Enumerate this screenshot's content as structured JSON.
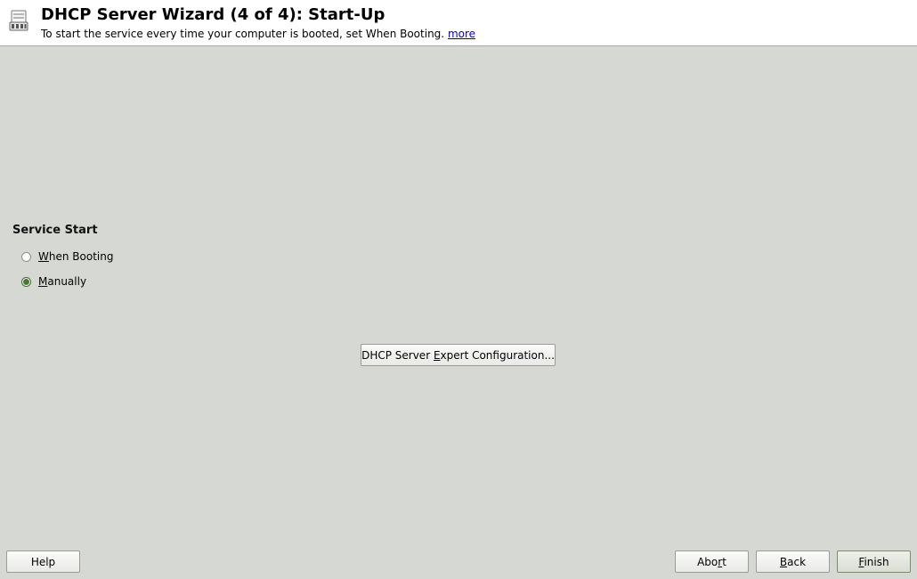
{
  "header": {
    "title": "DHCP Server Wizard (4 of 4): Start-Up",
    "subtitle": "To start the service every time your computer is booted, set When Booting.",
    "more_link": "more",
    "icon": "server-icon"
  },
  "service_start": {
    "label": "Service Start",
    "options": [
      {
        "prefix": "",
        "mnemonic": "W",
        "rest": "hen Booting",
        "selected": false
      },
      {
        "prefix": "",
        "mnemonic": "M",
        "rest": "anually",
        "selected": true
      }
    ]
  },
  "expert_button": {
    "prefix": "DHCP Server ",
    "mnemonic": "E",
    "rest": "xpert Configuration..."
  },
  "footer": {
    "help": "Help",
    "abort": {
      "prefix": "Abo",
      "mnemonic": "r",
      "rest": "t"
    },
    "back": {
      "prefix": "",
      "mnemonic": "B",
      "rest": "ack"
    },
    "finish": {
      "prefix": "",
      "mnemonic": "F",
      "rest": "inish"
    }
  },
  "colors": {
    "background": "#d6d9d3",
    "header_background": "#ffffff",
    "radio_selected": "#4a7a32",
    "link": "#0000cc"
  }
}
